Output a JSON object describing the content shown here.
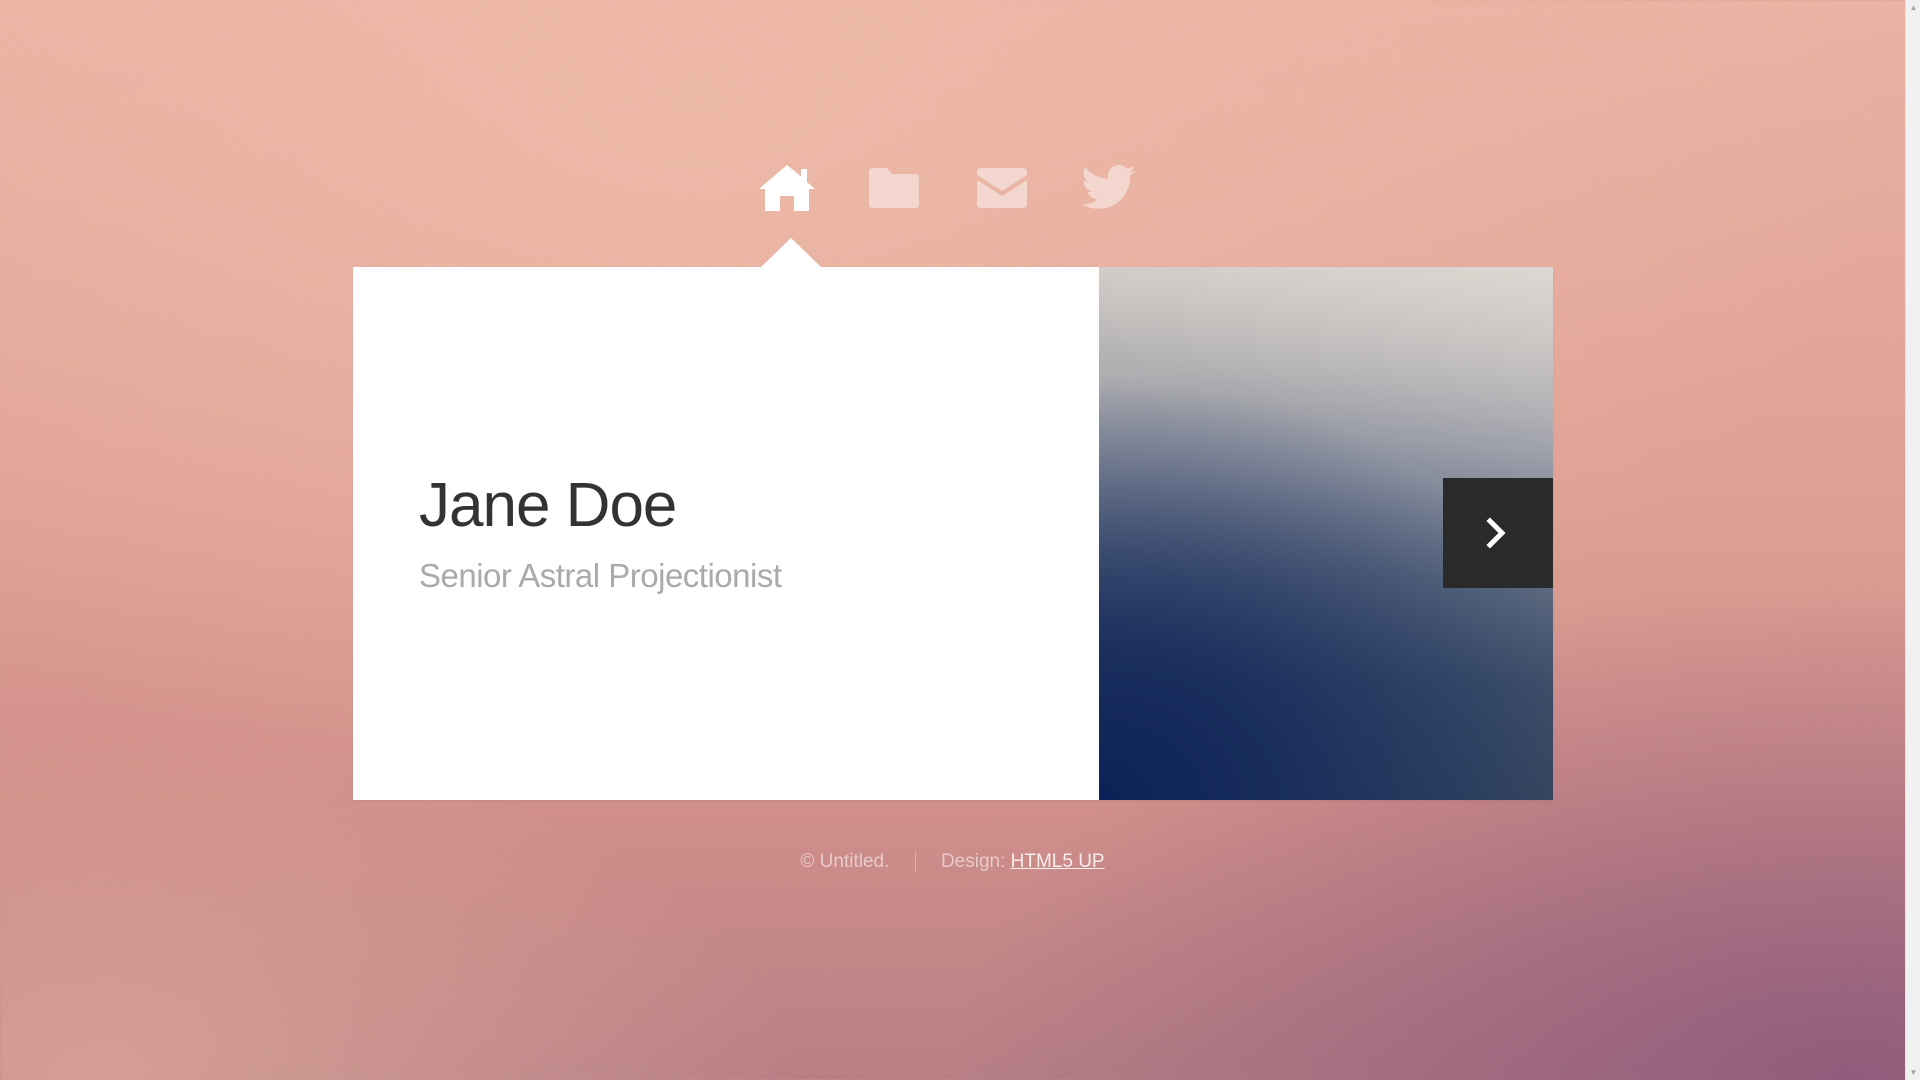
{
  "nav": {
    "items": [
      {
        "icon": "home-icon",
        "active": true
      },
      {
        "icon": "folder-icon",
        "active": false
      },
      {
        "icon": "envelope-icon",
        "active": false
      },
      {
        "icon": "twitter-icon",
        "active": false
      }
    ]
  },
  "profile": {
    "name": "Jane Doe",
    "title": "Senior Astral Projectionist"
  },
  "footer": {
    "copyright": "© Untitled.",
    "design_label": "Design:",
    "design_link": "HTML5 UP"
  },
  "colors": {
    "active_icon": "#ffffff",
    "inactive_icon": "#f3d7cf",
    "card_bg": "#ffffff",
    "name": "#333333",
    "title": "#aaaaaa",
    "next_button": "#2a2a2a"
  }
}
